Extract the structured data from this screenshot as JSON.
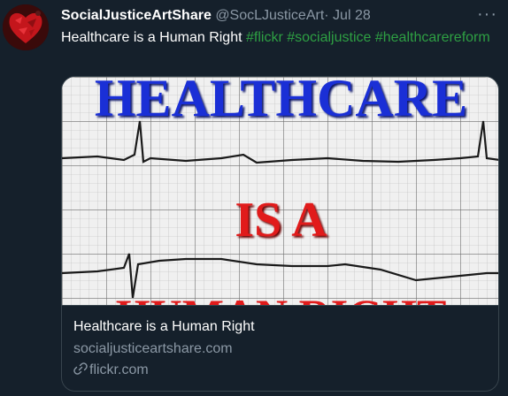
{
  "tweet": {
    "display_name": "SocialJusticeArtShare",
    "handle": "@SocLJusticeArt",
    "separator": "·",
    "date": "Jul 28",
    "more_icon": "more-horizontal-icon",
    "text": "Healthcare is a Human Right",
    "hashtags": [
      "#flickr",
      "#socialjustice",
      "#healthcarereform"
    ]
  },
  "card": {
    "image_text": [
      "HEALTHCARE",
      "IS A",
      "HUMAN RIGHT"
    ],
    "title": "Healthcare is a Human Right",
    "description": "socialjusticeartshare.com",
    "domain": "flickr.com",
    "domain_icon": "link-icon"
  },
  "colors": {
    "background": "#15202b",
    "hashtag": "#2ea043",
    "secondary_text": "#8b98a5",
    "border": "#38444d",
    "image_word_blue": "#1a2fd6",
    "image_word_red": "#e11b1b"
  }
}
